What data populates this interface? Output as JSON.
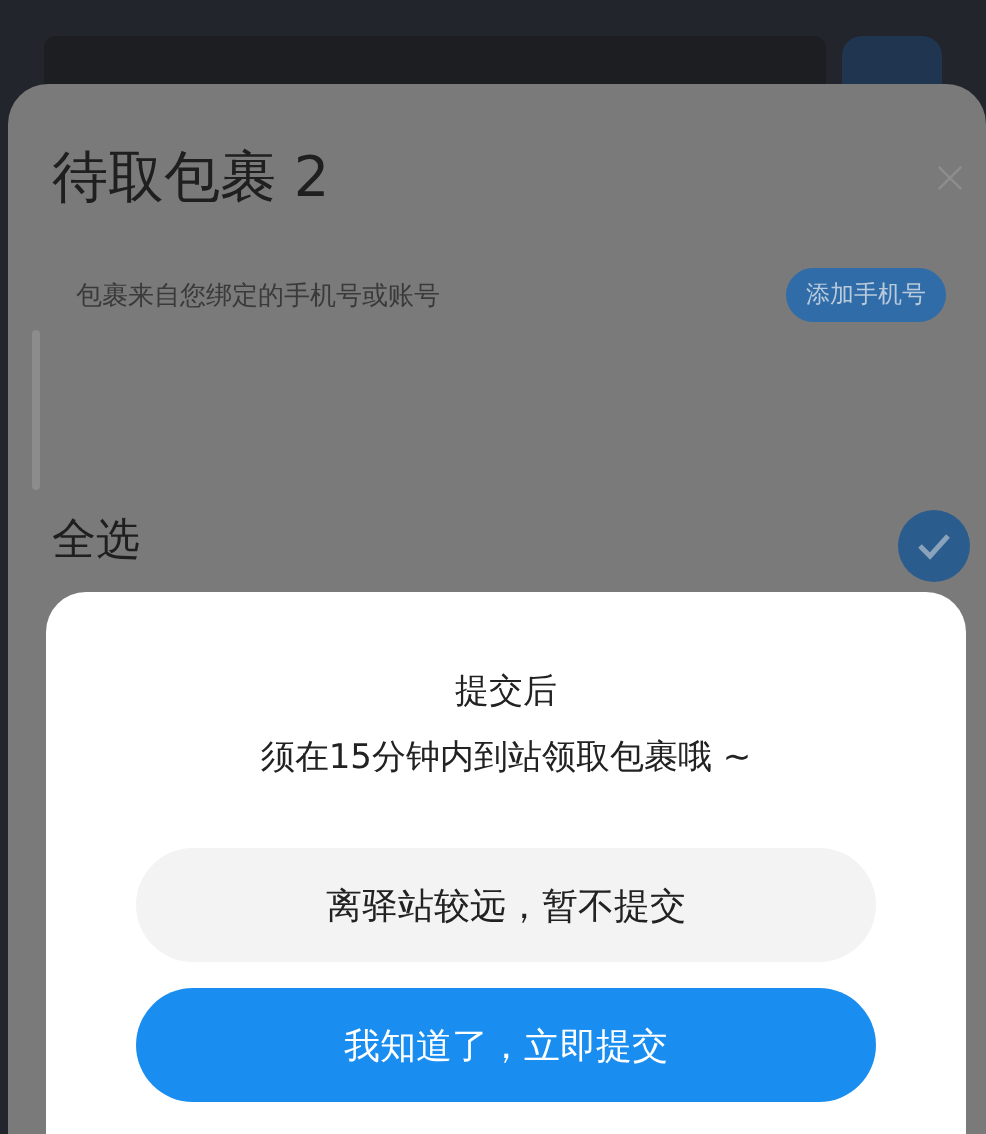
{
  "sheet": {
    "title": "待取包裹 2",
    "subtitle": "包裹来自您绑定的手机号或账号",
    "add_button": "添加手机号",
    "select_all": {
      "label": "全选",
      "checked": true
    }
  },
  "dialog": {
    "lines": [
      "提交后",
      "须在15分钟内到站领取包裹哦 ~"
    ],
    "buttons": [
      {
        "label": "离驿站较远，暂不提交",
        "kind": "secondary"
      },
      {
        "label": "我知道了，立即提交",
        "kind": "primary"
      }
    ]
  }
}
